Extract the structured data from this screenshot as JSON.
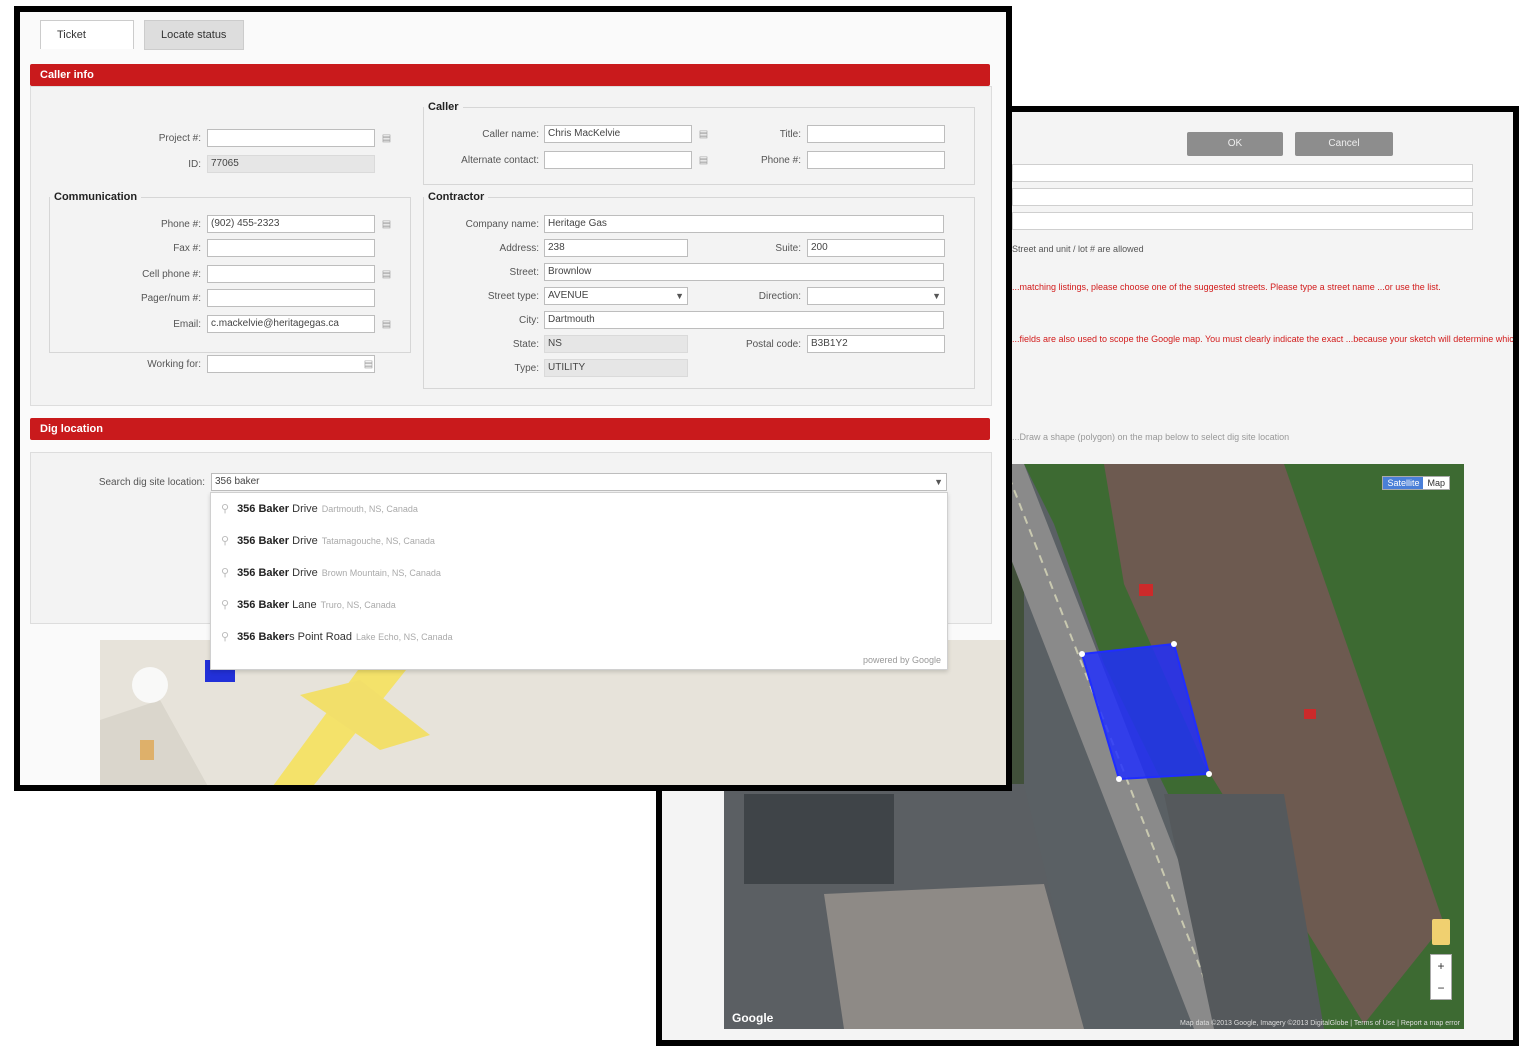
{
  "back_window": {
    "buttons": [
      "OK",
      "Cancel"
    ],
    "note": "Street and unit / lot # are allowed",
    "warning1": "...matching listings, please choose one of the suggested streets. Please type a street name ...or use the list.",
    "warning2": "...fields are also used to scope the Google map. You must clearly indicate the exact ...because your sketch will determine which locations will be notified of your...",
    "hint": "...Draw a shape (polygon) on the map below to select dig site location",
    "map_type": [
      "Satellite",
      "Map"
    ],
    "map_brand": "Google",
    "map_footer": "Map data ©2013 Google, Imagery ©2013 DigitalGlobe | Terms of Use | Report a map error",
    "zoom_plus": "+",
    "zoom_minus": "−"
  },
  "front_window": {
    "tabs": [
      "Ticket",
      "Locate status"
    ],
    "caller_info_title": "Caller info",
    "project_label": "Project #:",
    "id_label": "ID:",
    "id_value": "77065",
    "caller": {
      "legend": "Caller",
      "caller_name_label": "Caller name:",
      "caller_name": "Chris MacKelvie",
      "alt_contact_label": "Alternate contact:",
      "title_label": "Title:",
      "phone_label": "Phone #:"
    },
    "communication": {
      "legend": "Communication",
      "phone_label": "Phone #:",
      "phone": "(902) 455-2323",
      "fax_label": "Fax #:",
      "cell_label": "Cell phone #:",
      "pager_label": "Pager/num #:",
      "email_label": "Email:",
      "email": "c.mackelvie@heritagegas.ca",
      "working_for_label": "Working for:"
    },
    "contractor": {
      "legend": "Contractor",
      "company_label": "Company name:",
      "company": "Heritage Gas",
      "address_label": "Address:",
      "address": "238",
      "suite_label": "Suite:",
      "suite": "200",
      "street_label": "Street:",
      "street": "Brownlow",
      "street_type_label": "Street type:",
      "street_type": "AVENUE",
      "direction_label": "Direction:",
      "city_label": "City:",
      "city": "Dartmouth",
      "state_label": "State:",
      "state": "NS",
      "postal_label": "Postal code:",
      "postal": "B3B1Y2",
      "type_label": "Type:",
      "type": "UTILITY"
    },
    "dig_location_title": "Dig location",
    "search_label": "Search dig site location:",
    "search_value": "356 baker",
    "suggestions": [
      {
        "bold": "356 Baker",
        "rest": " Drive",
        "sub": "Dartmouth, NS, Canada"
      },
      {
        "bold": "356 Baker",
        "rest": " Drive",
        "sub": "Tatamagouche, NS, Canada"
      },
      {
        "bold": "356 Baker",
        "rest": " Drive",
        "sub": "Brown Mountain, NS, Canada"
      },
      {
        "bold": "356 Baker",
        "rest": " Lane",
        "sub": "Truro, NS, Canada"
      },
      {
        "bold": "356 Baker",
        "rest": "s Point Road",
        "sub": "Lake Echo, NS, Canada"
      }
    ],
    "powered_by": "powered by Google"
  },
  "colors": {
    "section_red": "#c91a1c",
    "polygon_blue": "#1f2dff",
    "window_border": "#000000"
  }
}
